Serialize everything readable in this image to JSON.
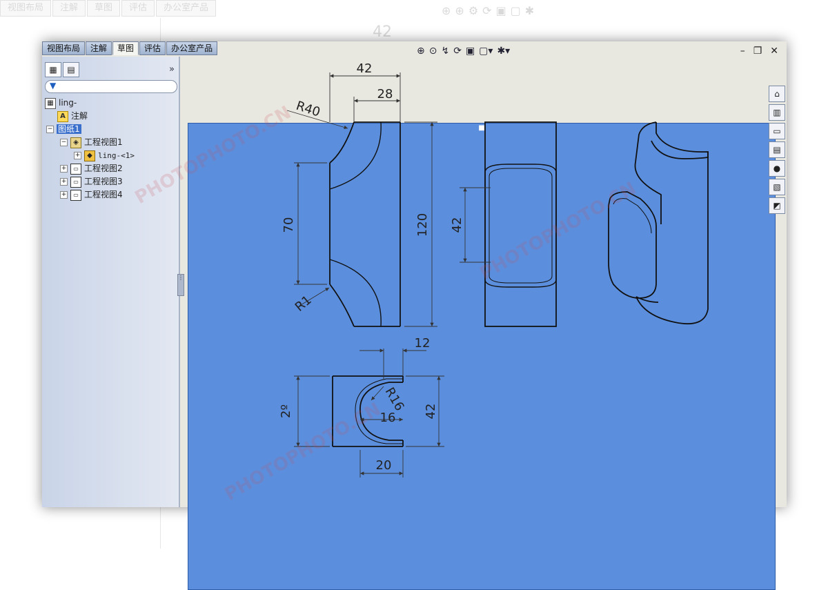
{
  "ghost": {
    "tabs": [
      "视图布局",
      "注解",
      "草图",
      "评估",
      "办公室产品"
    ],
    "dim": "42"
  },
  "tabs": [
    {
      "label": "视图布局"
    },
    {
      "label": "注解"
    },
    {
      "label": "草图",
      "active": true
    },
    {
      "label": "评估"
    },
    {
      "label": "办公室产品"
    }
  ],
  "panel": {
    "expand": "»",
    "tree": [
      {
        "label": "ling-"
      },
      {
        "label": "注解"
      },
      {
        "label": "图纸1",
        "selected": true
      },
      {
        "label": "工程视图1"
      },
      {
        "label": "ling-<1>"
      },
      {
        "label": "工程视图2"
      },
      {
        "label": "工程视图3"
      },
      {
        "label": "工程视图4"
      }
    ]
  },
  "window_controls": {
    "minimize": "–",
    "restore": "❐",
    "close": "✕"
  },
  "watermark": {
    "text": "PHOTOPHOTO.CN"
  },
  "dimensions": {
    "front_width": "42",
    "front_inner": "28",
    "front_radius": "R40",
    "front_height_inner": "70",
    "front_height": "120",
    "front_fillet": "R1",
    "side_height": "42",
    "top_offset": "12",
    "top_radius": "R16",
    "top_height_left": "2º",
    "top_height": "42",
    "top_inner": "16",
    "top_bottom": "20"
  },
  "colors": {
    "sheet": "#e9e8e0",
    "line": "#111111",
    "dim": "#333333"
  }
}
